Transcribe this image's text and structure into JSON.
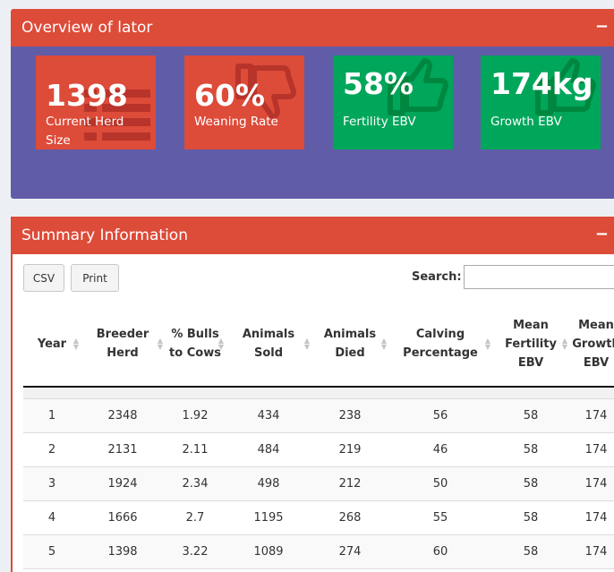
{
  "overview": {
    "title": "Overview of lator",
    "collapse": "−",
    "tiles": [
      {
        "value": "1398",
        "label": "Current Herd Size",
        "color": "#dd4b39",
        "icon": "list-icon"
      },
      {
        "value": "60%",
        "label": "Weaning Rate",
        "color": "#dd4b39",
        "icon": "thumbs-down-icon"
      },
      {
        "value": "58%",
        "label": "Fertility EBV",
        "color": "#00a65a",
        "icon": "thumbs-up-icon"
      },
      {
        "value": "174kg",
        "label": "Growth EBV",
        "color": "#00a65a",
        "icon": "thumbs-up-icon"
      }
    ]
  },
  "summary": {
    "title": "Summary Information",
    "collapse": "−",
    "csv_label": "CSV",
    "print_label": "Print",
    "search_label": "Search:",
    "search_value": "",
    "columns": [
      "Year",
      "Breeder Herd",
      "% Bulls to Cows",
      "Animals Sold",
      "Animals Died",
      "Calving Percentage",
      "Mean Fertility EBV",
      "Mean Growth EBV"
    ],
    "rows": [
      [
        "1",
        "2348",
        "1.92",
        "434",
        "238",
        "56",
        "58",
        "174"
      ],
      [
        "2",
        "2131",
        "2.11",
        "484",
        "219",
        "46",
        "58",
        "174"
      ],
      [
        "3",
        "1924",
        "2.34",
        "498",
        "212",
        "50",
        "58",
        "174"
      ],
      [
        "4",
        "1666",
        "2.7",
        "1195",
        "268",
        "55",
        "58",
        "174"
      ],
      [
        "5",
        "1398",
        "3.22",
        "1089",
        "274",
        "60",
        "58",
        "174"
      ]
    ]
  }
}
